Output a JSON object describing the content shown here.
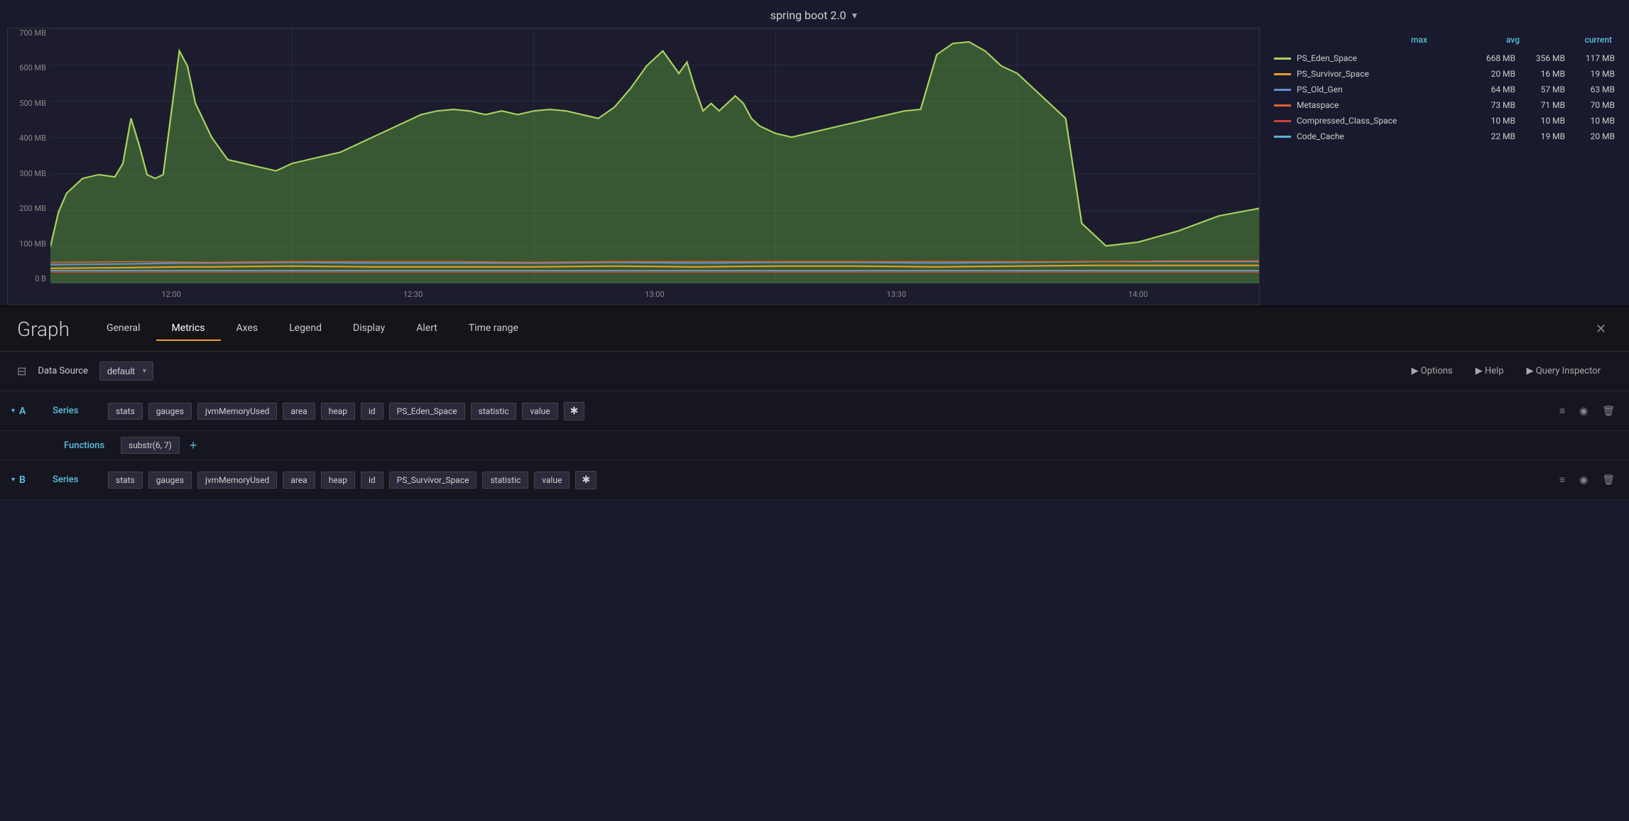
{
  "dashboard": {
    "title": "spring boot 2.0"
  },
  "chart": {
    "y_labels": [
      "700 MB",
      "600 MB",
      "500 MB",
      "400 MB",
      "300 MB",
      "200 MB",
      "100 MB",
      "0 B"
    ],
    "x_labels": [
      "12:00",
      "12:30",
      "13:00",
      "13:30",
      "14:00"
    ],
    "legend_headers": [
      "max",
      "avg",
      "current"
    ],
    "legend_items": [
      {
        "name": "PS_Eden_Space",
        "color": "#a8d060",
        "max": "668 MB",
        "avg": "356 MB",
        "current": "117 MB"
      },
      {
        "name": "PS_Survivor_Space",
        "color": "#e0a030",
        "max": "20 MB",
        "avg": "16 MB",
        "current": "19 MB"
      },
      {
        "name": "PS_Old_Gen",
        "color": "#6090d0",
        "max": "64 MB",
        "avg": "57 MB",
        "current": "63 MB"
      },
      {
        "name": "Metaspace",
        "color": "#e06030",
        "max": "73 MB",
        "avg": "71 MB",
        "current": "70 MB"
      },
      {
        "name": "Compressed_Class_Space",
        "color": "#d04040",
        "max": "10 MB",
        "avg": "10 MB",
        "current": "10 MB"
      },
      {
        "name": "Code_Cache",
        "color": "#60b0d0",
        "max": "22 MB",
        "avg": "19 MB",
        "current": "20 MB"
      }
    ]
  },
  "panel": {
    "title": "Graph",
    "close_label": "✕",
    "tabs": [
      {
        "id": "general",
        "label": "General"
      },
      {
        "id": "metrics",
        "label": "Metrics",
        "active": true
      },
      {
        "id": "axes",
        "label": "Axes"
      },
      {
        "id": "legend",
        "label": "Legend"
      },
      {
        "id": "display",
        "label": "Display"
      },
      {
        "id": "alert",
        "label": "Alert"
      },
      {
        "id": "timerange",
        "label": "Time range"
      }
    ]
  },
  "datasource": {
    "label": "Data Source",
    "value": "default",
    "options_label": "▶ Options",
    "help_label": "▶ Help",
    "query_inspector_label": "▶ Query Inspector"
  },
  "queries": [
    {
      "id": "A",
      "series_label": "Series",
      "tags": [
        "stats",
        "gauges",
        "jvmMemoryUsed",
        "area",
        "heap",
        "id",
        "PS_Eden_Space",
        "statistic",
        "value"
      ],
      "has_asterisk": true,
      "functions_label": "Functions",
      "functions": [
        "substr(6, 7)"
      ],
      "add_function_label": "+"
    },
    {
      "id": "B",
      "series_label": "Series",
      "tags": [
        "stats",
        "gauges",
        "jvmMemoryUsed",
        "area",
        "heap",
        "id",
        "PS_Survivor_Space",
        "statistic",
        "value"
      ],
      "has_asterisk": true
    }
  ],
  "icons": {
    "datasource": "⊟",
    "collapse": "▾",
    "menu": "≡",
    "eye": "◉",
    "trash": "🗑",
    "chevron_right": "▶"
  }
}
